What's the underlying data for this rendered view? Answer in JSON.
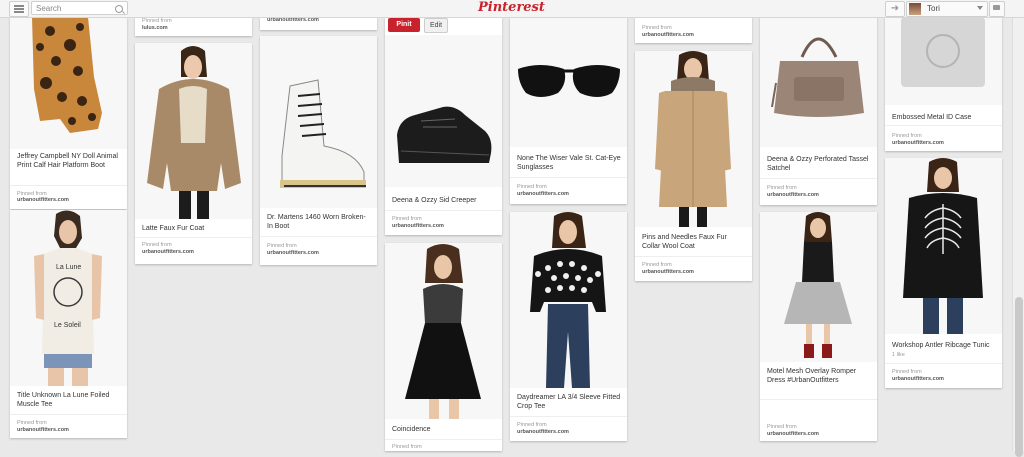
{
  "header": {
    "search_placeholder": "Search",
    "logo": "Pinterest",
    "user_name": "Tori"
  },
  "pins": {
    "jeffrey": {
      "desc": "Jeffrey Campbell NY Doll Animal Print Calf Hair Platform Boot",
      "via": "Pinned from",
      "src": "urbanoutfitters.com"
    },
    "title_unknown": {
      "desc": "Title Unknown La Lune Foiled Muscle Tee",
      "via": "Pinned from",
      "src": "urbanoutfitters.com",
      "shirt_text": [
        "La Lune",
        "Le Soleil"
      ]
    },
    "col2_top": {
      "via": "Pinned from",
      "src": "lulus.com"
    },
    "latte": {
      "desc": "Latte Faux Fur Coat",
      "via": "Pinned from",
      "src": "urbanoutfitters.com"
    },
    "col3_top": {
      "src": "urbanoutfitters.com"
    },
    "martens": {
      "desc": "Dr. Martens 1460 Worn Broken-In Boot",
      "via": "Pinned from",
      "src": "urbanoutfitters.com"
    },
    "deena_creeper": {
      "pinit": "Pinit",
      "edit": "Edit",
      "desc": "Deena & Ozzy Sid Creeper",
      "via": "Pinned from",
      "src": "urbanoutfitters.com"
    },
    "coincidence": {
      "desc": "Coincidence",
      "via": "Pinned from"
    },
    "sunglasses": {
      "desc": "None The Wiser Vale St. Cat-Eye Sunglasses",
      "via": "Pinned from",
      "src": "urbanoutfitters.com"
    },
    "daydreamer": {
      "desc": "Daydreamer LA 3/4 Sleeve Fitted Crop Tee",
      "via": "Pinned from",
      "src": "urbanoutfitters.com"
    },
    "col6_top": {
      "via": "Pinned from",
      "src": "urbanoutfitters.com"
    },
    "pins_needles": {
      "desc": "Pins and Needles Faux Fur Collar Wool Coat",
      "via": "Pinned from",
      "src": "urbanoutfitters.com"
    },
    "satchel": {
      "desc": "Deena & Ozzy Perforated Tassel Satchel",
      "via": "Pinned from",
      "src": "urbanoutfitters.com"
    },
    "romper": {
      "desc": "Motel Mesh Overlay Romper Dress #UrbanOutfitters",
      "via": "Pinned from",
      "src": "urbanoutfitters.com"
    },
    "id_case": {
      "desc": "Embossed Metal ID Case",
      "via": "Pinned from",
      "src": "urbanoutfitters.com"
    },
    "antler": {
      "desc": "Workshop Antler Ribcage Tunic",
      "likes": "1 like",
      "via": "Pinned from",
      "src": "urbanoutfitters.com"
    }
  }
}
